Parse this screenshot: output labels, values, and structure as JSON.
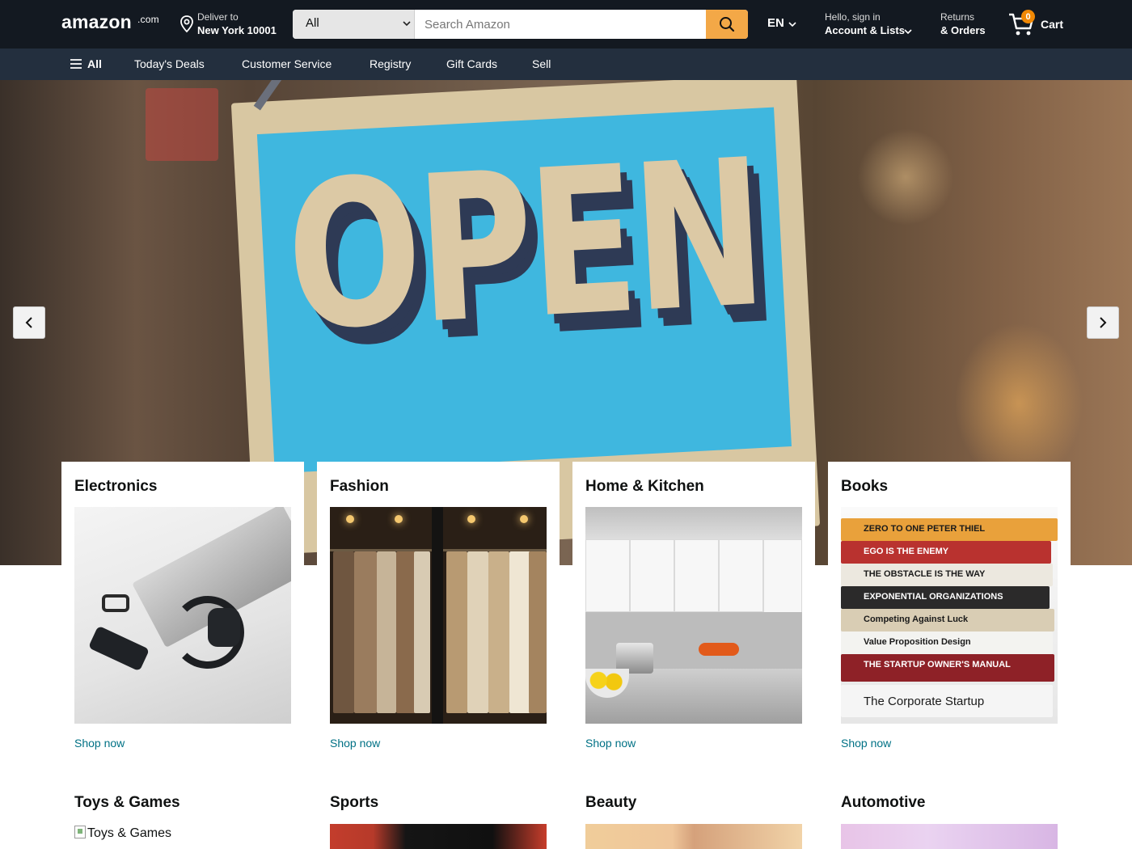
{
  "header": {
    "logo": "amazon",
    "logo_suffix": ".com",
    "deliver_line1": "Deliver to",
    "deliver_line2": "New York 10001",
    "search_category": "All",
    "search_placeholder": "Search Amazon",
    "language": "EN",
    "account_line1": "Hello, sign in",
    "account_line2": "Account & Lists",
    "returns_line1": "Returns",
    "returns_line2": "& Orders",
    "cart_count": "0",
    "cart_label": "Cart"
  },
  "subnav": {
    "all_label": "All",
    "items": [
      "Today's Deals",
      "Customer Service",
      "Registry",
      "Gift Cards",
      "Sell"
    ]
  },
  "hero": {
    "sign_text": "OPEN"
  },
  "categories": [
    {
      "title": "Electronics",
      "link": "Shop now"
    },
    {
      "title": "Fashion",
      "link": "Shop now"
    },
    {
      "title": "Home & Kitchen",
      "link": "Shop now"
    },
    {
      "title": "Books",
      "link": "Shop now"
    },
    {
      "title": "Toys & Games",
      "image_alt": "Toys & Games"
    },
    {
      "title": "Sports"
    },
    {
      "title": "Beauty"
    },
    {
      "title": "Automotive"
    }
  ],
  "books_art": [
    {
      "text": "ZERO TO ONE   PETER THIEL",
      "color": "#e9a13b"
    },
    {
      "text": "EGO IS THE ENEMY",
      "color": "#b9322f"
    },
    {
      "text": "THE OBSTACLE IS THE WAY",
      "color": "#ece8df"
    },
    {
      "text": "EXPONENTIAL ORGANIZATIONS",
      "color": "#2b2a2a"
    },
    {
      "text": "Competing Against Luck",
      "color": "#d9cdb4"
    },
    {
      "text": "Value Proposition Design",
      "color": "#f3f3f0"
    },
    {
      "text": "THE STARTUP OWNER'S MANUAL",
      "color": "#8e2127"
    },
    {
      "text": "The Corporate Startup",
      "color": "#f5f5f5"
    }
  ],
  "colors": {
    "header_bg": "#131921",
    "subnav_bg": "#232f3e",
    "search_button": "#f3a847",
    "cart_badge": "#f08804",
    "link": "#007185"
  }
}
